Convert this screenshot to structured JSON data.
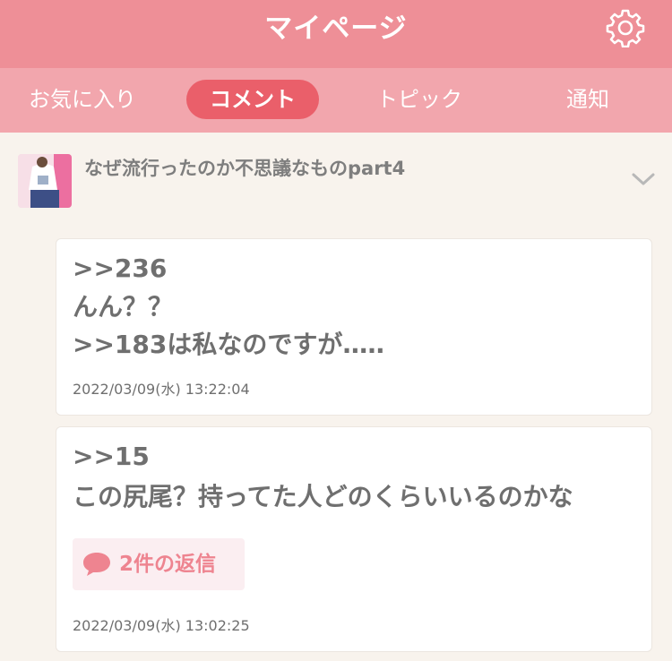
{
  "header": {
    "title": "マイページ",
    "settings_icon": "gear-icon"
  },
  "tabs": [
    {
      "label": "お気に入り",
      "active": false
    },
    {
      "label": "コメント",
      "active": true
    },
    {
      "label": "トピック",
      "active": false
    },
    {
      "label": "通知",
      "active": false
    }
  ],
  "topic": {
    "title": "なぜ流行ったのか不思議なものpart4",
    "expand_icon": "chevron-down-icon"
  },
  "comments": [
    {
      "lines": [
        ">>236",
        "んん？？",
        ">>183は私なのですが‥…"
      ],
      "timestamp": "2022/03/09(水) 13:22:04"
    },
    {
      "lines": [
        ">>15",
        "この尻尾？持ってた人どのくらいいるのかな"
      ],
      "reply_label": "2件の返信",
      "timestamp": "2022/03/09(水) 13:02:25"
    }
  ],
  "colors": {
    "header": "#ee8f97",
    "tab_bar": "#f2a6ad",
    "active_tab": "#ea5f6a",
    "reply_text": "#ee8490",
    "background": "#f8f3ed"
  }
}
